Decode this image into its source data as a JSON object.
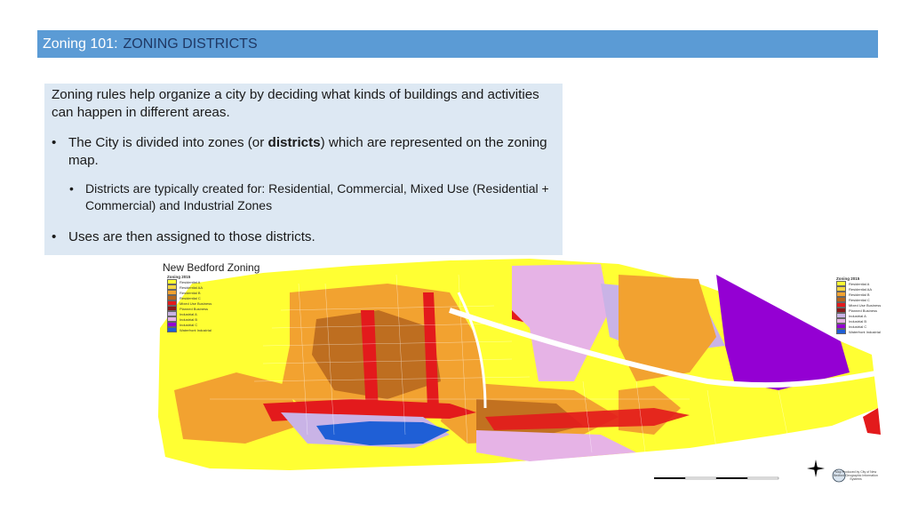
{
  "header": {
    "prefix": "Zoning 101:",
    "title": "ZONING DISTRICTS",
    "bar_color": "#5b9bd5"
  },
  "content": {
    "intro": "Zoning rules help organize a city by deciding what kinds of buildings and activities can happen in different areas.",
    "bullet1_before": "The City is divided into zones (or ",
    "bullet1_bold": "districts",
    "bullet1_after": ") which are represented on the zoning map.",
    "sub_bullet": "Districts are typically created for: Residential, Commercial, Mixed Use (Residential + Commercial) and Industrial Zones",
    "bullet2": "Uses are then assigned to those districts.",
    "bullet_glyph": "•"
  },
  "map": {
    "title": "New Bedford Zoning",
    "legend_title": "Zoning 2015",
    "legend": [
      {
        "label": "Residential A",
        "color": "#ffff33"
      },
      {
        "label": "Residential AA",
        "color": "#f5d742"
      },
      {
        "label": "Residential B",
        "color": "#f2a230"
      },
      {
        "label": "Residential C",
        "color": "#b5651d"
      },
      {
        "label": "Mixed Use Business",
        "color": "#e31a1c"
      },
      {
        "label": "Planned Business",
        "color": "#8b1a1a"
      },
      {
        "label": "Industrial A",
        "color": "#c9b3e6"
      },
      {
        "label": "Industrial B",
        "color": "#e6b3e6"
      },
      {
        "label": "Industrial C",
        "color": "#9400d3"
      },
      {
        "label": "Waterfront Industrial",
        "color": "#1f5fd6"
      }
    ],
    "credit": "Map Produced by City of New Bedford Geographic Information Systems"
  }
}
